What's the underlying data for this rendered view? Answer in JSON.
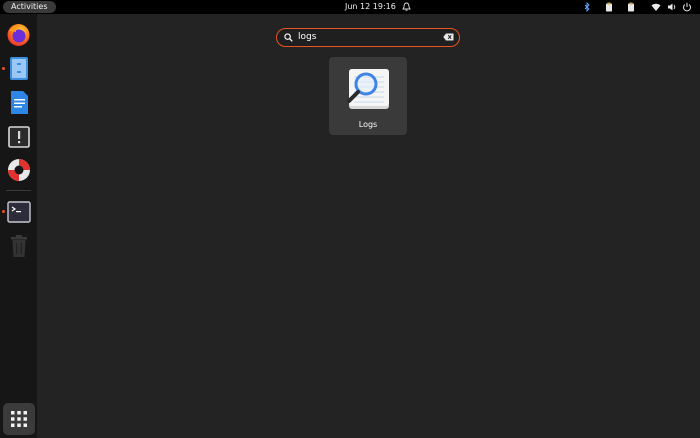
{
  "topbar": {
    "activities_label": "Activities",
    "clock": "Jun 12  19:16",
    "tray_icons": [
      "bluetooth-icon",
      "clipboard-icon",
      "clipboard-icon",
      "wifi-icon",
      "volume-icon",
      "power-icon"
    ]
  },
  "dock": {
    "items": [
      {
        "name": "firefox",
        "running": false
      },
      {
        "name": "files",
        "running": true
      },
      {
        "name": "text-editor",
        "running": false
      },
      {
        "name": "software-updater",
        "running": false
      },
      {
        "name": "help",
        "running": false
      },
      {
        "name": "terminal",
        "running": true
      },
      {
        "name": "trash",
        "running": false
      }
    ],
    "show_apps_icon": "app-grid-icon"
  },
  "search": {
    "query": "logs"
  },
  "results": [
    {
      "label": "Logs",
      "icon": "logs-icon"
    }
  ],
  "colors": {
    "accent": "#e95420",
    "background": "#232323",
    "dock": "#161616",
    "topbar": "#000000"
  }
}
